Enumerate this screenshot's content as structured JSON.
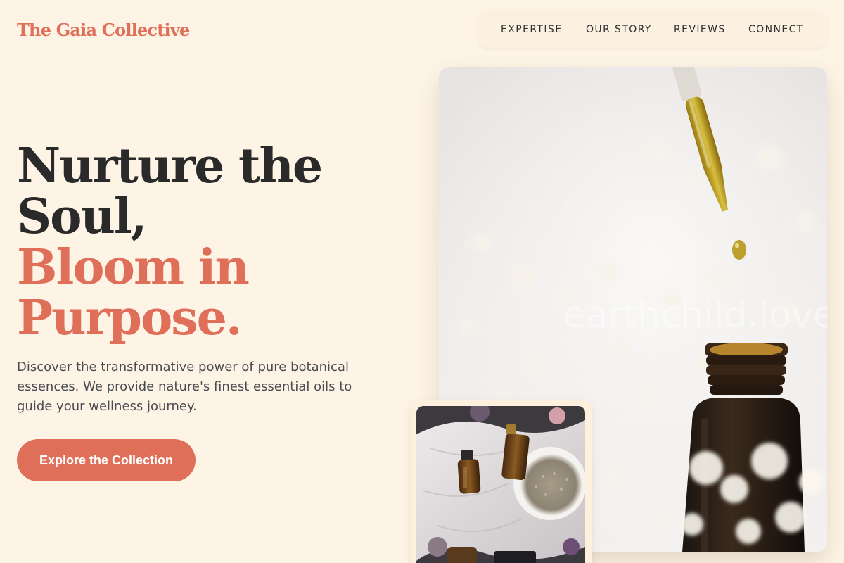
{
  "brand": {
    "name": "The Gaia Collective"
  },
  "nav": {
    "items": [
      {
        "label": "EXPERTISE"
      },
      {
        "label": "OUR STORY"
      },
      {
        "label": "REVIEWS"
      },
      {
        "label": "CONNECT"
      }
    ]
  },
  "hero": {
    "headline_line1": "Nurture the",
    "headline_line2": "Soul,",
    "headline_accent_line1": "Bloom in",
    "headline_accent_line2": "Purpose.",
    "description": "Discover the transformative power of pure botanical essences. We provide nature's finest essential oils to guide your wellness journey.",
    "cta_label": "Explore the Collection",
    "image_watermark": "earthchild.love"
  },
  "colors": {
    "background": "#fdf4e6",
    "accent": "#df6f58",
    "heading": "#2a2a2a",
    "body_text": "#4b4b52"
  }
}
